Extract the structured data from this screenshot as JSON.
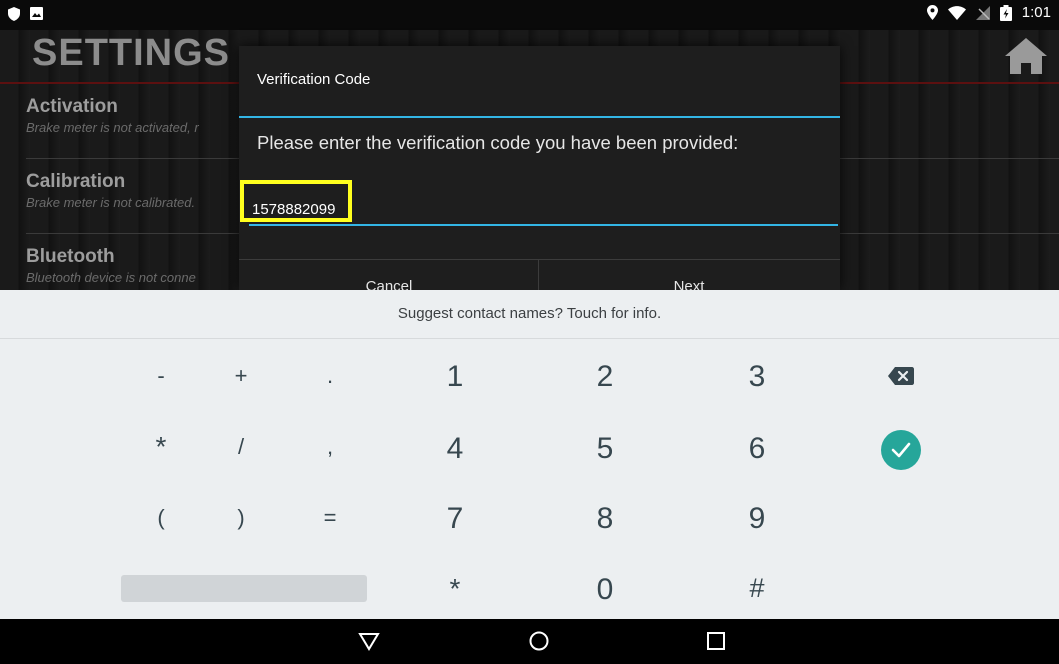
{
  "status_bar": {
    "time": "1:01",
    "left_icons": [
      "shield-icon",
      "image-icon"
    ],
    "right_icons": [
      "location-icon",
      "wifi-icon",
      "no-signal-icon",
      "battery-icon"
    ]
  },
  "app": {
    "title": "SETTINGS",
    "home_icon": "home-icon",
    "items": [
      {
        "title": "Activation",
        "subtitle": "Brake meter is not activated, r"
      },
      {
        "title": "Calibration",
        "subtitle": "Brake meter is not calibrated."
      },
      {
        "title": "Bluetooth",
        "subtitle": "Bluetooth device is not conne"
      }
    ]
  },
  "dialog": {
    "title": "Verification Code",
    "message": "Please enter the verification code you have been provided:",
    "input_value": "1578882099",
    "cancel_label": "Cancel",
    "next_label": "Next",
    "accent_color": "#33b5e5"
  },
  "keyboard": {
    "suggestion": "Suggest contact names? Touch for info.",
    "rows": [
      [
        "-",
        "+",
        ".",
        "1",
        "2",
        "3"
      ],
      [
        "*",
        "/",
        ",",
        "4",
        "5",
        "6"
      ],
      [
        "(",
        ")",
        "=",
        "7",
        "8",
        "9"
      ],
      [
        "*",
        "0",
        "#"
      ]
    ],
    "backspace_icon": "backspace-icon",
    "enter_icon": "check-icon",
    "enter_color": "#26a69a"
  },
  "nav_bar": {
    "icons": [
      "back-icon",
      "home-circle-icon",
      "recents-icon"
    ]
  }
}
